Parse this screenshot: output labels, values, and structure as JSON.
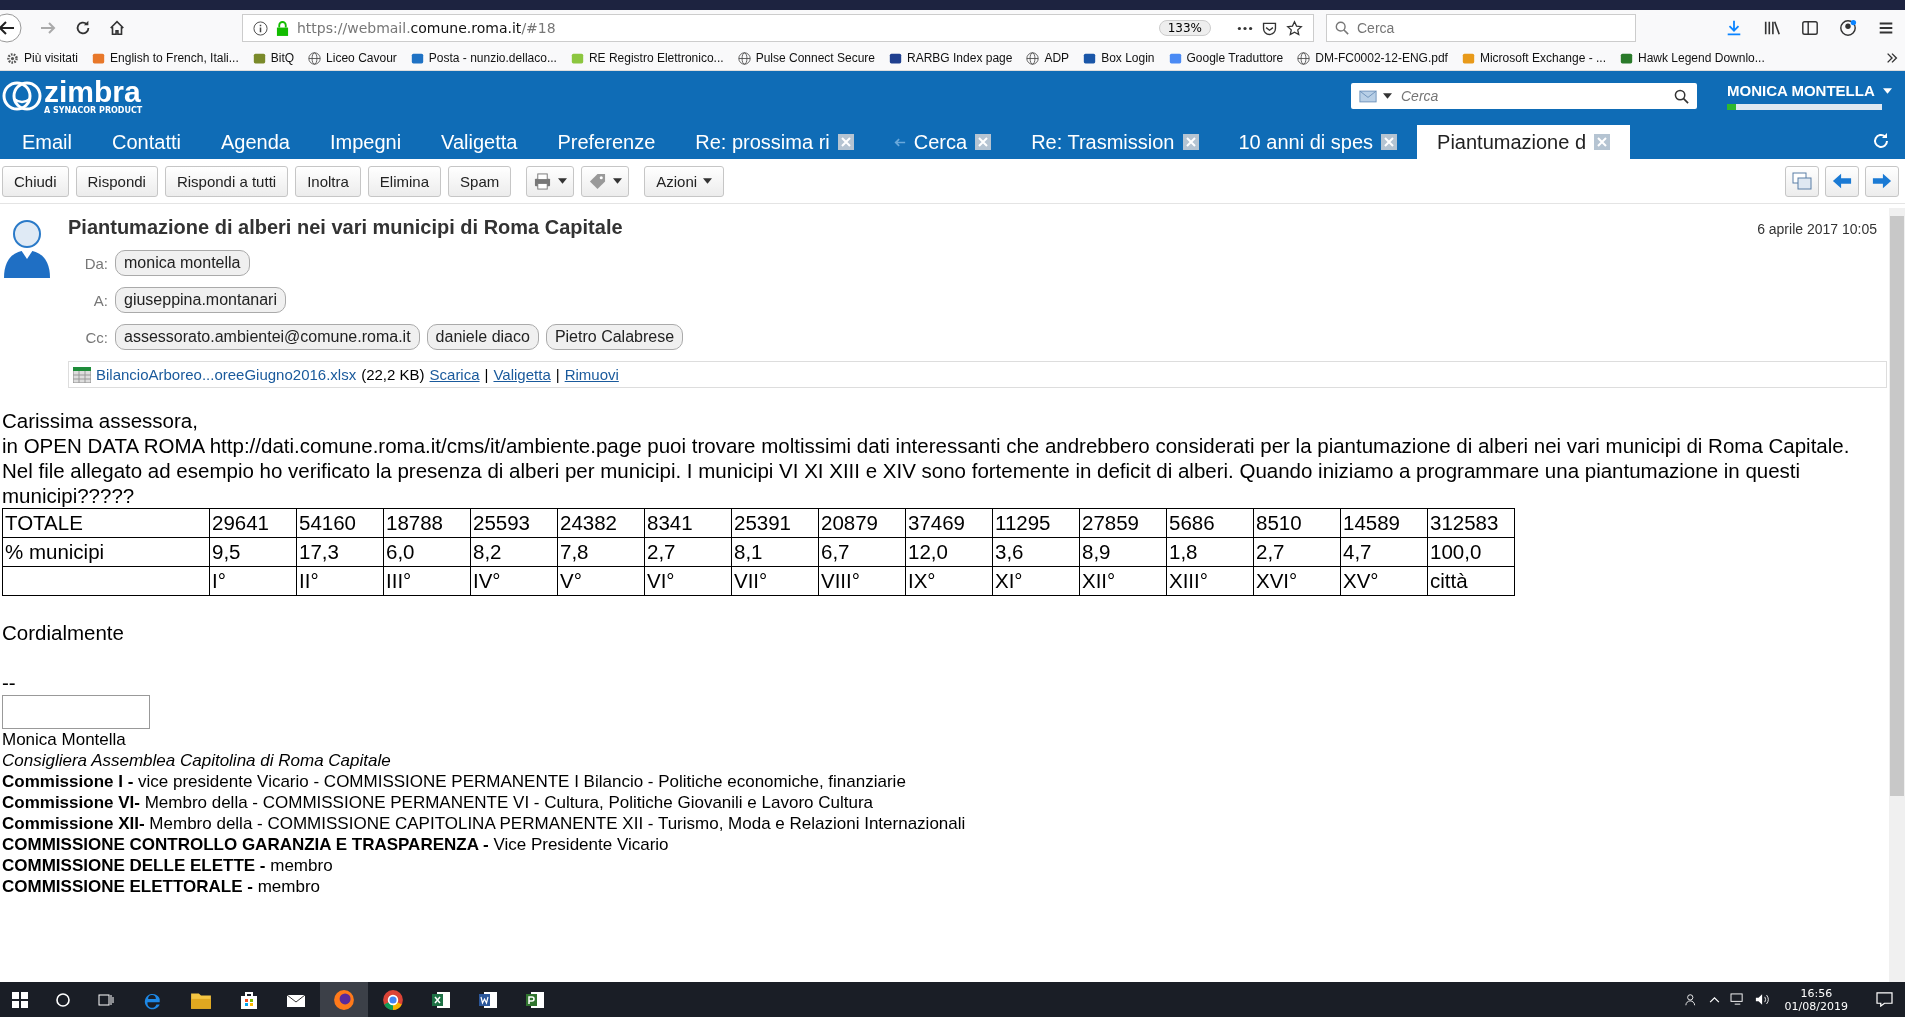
{
  "browser": {
    "url_prefix": "https://webmail.",
    "url_domain": "comune.roma.it",
    "url_suffix": "/#18",
    "zoom": "133%",
    "search_placeholder": "Cerca",
    "bookmarks": [
      {
        "label": "Più visitati",
        "kind": "gear"
      },
      {
        "label": "English to French, Itali...",
        "kind": "tile",
        "color": "#e8782a"
      },
      {
        "label": "BitQ",
        "kind": "tile",
        "color": "#7a8a2a"
      },
      {
        "label": "Liceo Cavour",
        "kind": "globe"
      },
      {
        "label": "Posta - nunzio.dellaco...",
        "kind": "tile",
        "color": "#1f72c4"
      },
      {
        "label": "RE Registro Elettronico...",
        "kind": "tile",
        "color": "#8cc63f"
      },
      {
        "label": "Pulse Connect Secure",
        "kind": "globe"
      },
      {
        "label": "RARBG Index page",
        "kind": "tile",
        "color": "#1f3f8f"
      },
      {
        "label": "ADP",
        "kind": "globe"
      },
      {
        "label": "Box Login",
        "kind": "tile",
        "color": "#1a56a8"
      },
      {
        "label": "Google Traduttore",
        "kind": "tile",
        "color": "#4a8af4"
      },
      {
        "label": "DM-FC0002-12-ENG.pdf",
        "kind": "globe"
      },
      {
        "label": "Microsoft Exchange - ...",
        "kind": "tile",
        "color": "#e89a1a"
      },
      {
        "label": "Hawk Legend Downlo...",
        "kind": "tile",
        "color": "#2a7a2a"
      }
    ]
  },
  "app": {
    "logo": "zimbra",
    "logo_sub": "A SYNACOR PRODUCT",
    "search_placeholder": "Cerca",
    "user": "MONICA MONTELLA",
    "quota": {
      "level": 0.06
    },
    "tabs": [
      {
        "label": "Email",
        "closable": false,
        "selected": false
      },
      {
        "label": "Contatti",
        "closable": false,
        "selected": false
      },
      {
        "label": "Agenda",
        "closable": false,
        "selected": false
      },
      {
        "label": "Impegni",
        "closable": false,
        "selected": false
      },
      {
        "label": "Valigetta",
        "closable": false,
        "selected": false
      },
      {
        "label": "Preferenze",
        "closable": false,
        "selected": false
      },
      {
        "label": "Re: prossima ri",
        "closable": true,
        "selected": false
      },
      {
        "label": "Cerca",
        "closable": true,
        "selected": false,
        "kind": "search"
      },
      {
        "label": "Re: Trasmission",
        "closable": true,
        "selected": false
      },
      {
        "label": "10 anni di spes",
        "closable": true,
        "selected": false
      },
      {
        "label": "Piantumazione d",
        "closable": true,
        "selected": true
      }
    ],
    "toolbar": [
      {
        "kind": "button",
        "label": "Chiudi"
      },
      {
        "kind": "button",
        "label": "Rispondi"
      },
      {
        "kind": "button",
        "label": "Rispondi a tutti"
      },
      {
        "kind": "button",
        "label": "Inoltra"
      },
      {
        "kind": "button",
        "label": "Elimina"
      },
      {
        "kind": "button",
        "label": "Spam"
      },
      {
        "kind": "print"
      },
      {
        "kind": "tag"
      },
      {
        "kind": "menu",
        "label": "Azioni"
      }
    ]
  },
  "message": {
    "subject": "Piantumazione di alberi nei vari municipi di Roma Capitale",
    "date": "6 aprile 2017 10:05",
    "headers": [
      {
        "label": "Da:",
        "people": [
          "monica montella"
        ]
      },
      {
        "label": "A:",
        "people": [
          "giuseppina.montanari"
        ]
      },
      {
        "label": "Cc:",
        "people": [
          "assessorato.ambientei@comune.roma.it",
          "daniele diaco",
          "Pietro Calabrese"
        ]
      }
    ],
    "attachment": {
      "name": "BilancioArboreo...oreeGiugno2016.xlsx",
      "size": "(22,2 KB)",
      "links": [
        "Scarica",
        "Valigetta",
        "Rimuovi"
      ],
      "separators": [
        "|",
        "|"
      ]
    },
    "body": {
      "paragraphs": [
        "Carissima assessora,",
        "in OPEN DATA ROMA http://dati.comune.roma.it/cms/it/ambiente.page puoi trovare moltissimi dati interessanti che andrebbero considerati per la piantumazione di alberi nei vari municipi di Roma Capitale.",
        "Nel file allegato ad esempio ho verificato la presenza di alberi per municipi. I municipi VI XI XIII e XIV sono fortemente in deficit di alberi. Quando iniziamo a programmare una piantumazione in questi municipi?????"
      ],
      "table": [
        {
          "label": "TOTALE",
          "cells": [
            "29641",
            "54160",
            "18788",
            "25593",
            "24382",
            "8341",
            "25391",
            "20879",
            "37469",
            "11295",
            "27859",
            "5686",
            "8510",
            "14589",
            "312583"
          ]
        },
        {
          "label": "% municipi",
          "cells": [
            "9,5",
            "17,3",
            "6,0",
            "8,2",
            "7,8",
            "2,7",
            "8,1",
            "6,7",
            "12,0",
            "3,6",
            "8,9",
            "1,8",
            "2,7",
            "4,7",
            "100,0"
          ]
        },
        {
          "cells": [
            "I°",
            "II°",
            "III°",
            "IV°",
            "V°",
            "VI°",
            "VII°",
            "VIII°",
            "IX°",
            "XI°",
            "XII°",
            "XIII°",
            "XVI°",
            "XV°",
            "città"
          ]
        }
      ],
      "closing": "Cordialmente",
      "separator": "--",
      "signature": [
        {
          "kind": "plain",
          "text": "Monica Montella"
        },
        {
          "kind": "italic",
          "text": "Consigliera Assemblea Capitolina di Roma Capitale"
        },
        {
          "kind": "plain",
          "text": "**Commissione I -** vice presidente Vicario - COMMISSIONE PERMANENTE I Bilancio - Politiche economiche, finanziarie"
        },
        {
          "kind": "plain",
          "text": "**Commissione VI-** Membro della - COMMISSIONE PERMANENTE VI - Cultura, Politiche Giovanili e Lavoro Cultura"
        },
        {
          "kind": "plain",
          "text": "**Commissione XII-** Membro della - COMMISSIONE CAPITOLINA PERMANENTE XII - Turismo, Moda e Relazioni Internazionali"
        },
        {
          "kind": "plain",
          "text": "**COMMISSIONE CONTROLLO GARANZIA E TRASPARENZA -** Vice Presidente Vicario"
        },
        {
          "kind": "plain",
          "text": "**COMMISSIONE DELLE ELETTE -** membro"
        },
        {
          "kind": "plain",
          "text": "**COMMISSIONE ELETTORALE -** membro"
        }
      ]
    }
  },
  "taskbar": {
    "time": "16:56",
    "date": "01/08/2019"
  }
}
